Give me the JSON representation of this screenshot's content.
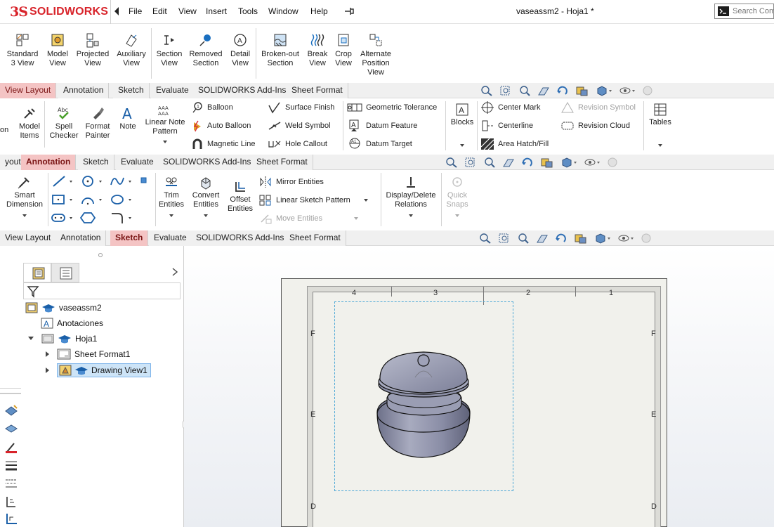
{
  "app": {
    "logo_prefix": "3S",
    "logo_name": "SOLIDWORKS",
    "brand_color": "#d8232a"
  },
  "menu": {
    "items": [
      "File",
      "Edit",
      "View",
      "Insert",
      "Tools",
      "Window",
      "Help"
    ]
  },
  "window": {
    "title": "vaseassm2 - Hoja1 *"
  },
  "search": {
    "placeholder": "Search Com"
  },
  "view_layout_toolbar": [
    {
      "label": "Standard\n3 View",
      "icon": "standard-3-view-icon"
    },
    {
      "label": "Model\nView",
      "icon": "model-view-icon"
    },
    {
      "label": "Projected\nView",
      "icon": "projected-view-icon"
    },
    {
      "label": "Auxiliary\nView",
      "icon": "auxiliary-view-icon"
    },
    {
      "label": "Section\nView",
      "icon": "section-view-icon"
    },
    {
      "label": "Removed\nSection",
      "icon": "removed-section-icon"
    },
    {
      "label": "Detail\nView",
      "icon": "detail-view-icon"
    },
    {
      "label": "Broken-out\nSection",
      "icon": "broken-out-section-icon"
    },
    {
      "label": "Break\nView",
      "icon": "break-view-icon"
    },
    {
      "label": "Crop\nView",
      "icon": "crop-view-icon"
    },
    {
      "label": "Alternate\nPosition\nView",
      "icon": "alternate-position-view-icon"
    }
  ],
  "tabs_row1": [
    "View Layout",
    "Annotation",
    "Sketch",
    "Evaluate",
    "SOLIDWORKS Add-Ins",
    "Sheet Format"
  ],
  "tabs_row1_active": "View Layout",
  "annotation_toolbar": {
    "partial_left": "on",
    "model_items": "Model\nItems",
    "spell_checker": "Spell\nChecker",
    "format_painter": "Format\nPainter",
    "note": "Note",
    "linear_note_pattern": "Linear Note\nPattern",
    "balloon": "Balloon",
    "auto_balloon": "Auto Balloon",
    "magnetic_line": "Magnetic Line",
    "surface_finish": "Surface Finish",
    "weld_symbol": "Weld Symbol",
    "hole_callout": "Hole Callout",
    "geometric_tolerance": "Geometric Tolerance",
    "datum_feature": "Datum Feature",
    "datum_target": "Datum Target",
    "blocks": "Blocks",
    "center_mark": "Center Mark",
    "centerline": "Centerline",
    "area_hatch": "Area Hatch/Fill",
    "revision_symbol": "Revision Symbol",
    "revision_cloud": "Revision Cloud",
    "tables": "Tables"
  },
  "tabs_row2": [
    "yout",
    "Annotation",
    "Sketch",
    "Evaluate",
    "SOLIDWORKS Add-Ins",
    "Sheet Format"
  ],
  "tabs_row2_active": "Annotation",
  "sketch_toolbar": {
    "smart_dimension": "Smart\nDimension",
    "trim_entities": "Trim\nEntities",
    "convert_entities": "Convert\nEntities",
    "offset_entities": "Offset\nEntities",
    "mirror_entities": "Mirror Entities",
    "linear_sketch_pattern": "Linear Sketch Pattern",
    "move_entities": "Move Entities",
    "display_delete_relations": "Display/Delete\nRelations",
    "quick_snaps": "Quick\nSnaps"
  },
  "tabs_row3": [
    "View Layout",
    "Annotation",
    "Sketch",
    "Evaluate",
    "SOLIDWORKS Add-Ins",
    "Sheet Format"
  ],
  "tabs_row3_active": "Sketch",
  "feature_tree": {
    "root": "vaseassm2",
    "items": [
      {
        "label": "Anotaciones",
        "icon": "annotations-icon"
      },
      {
        "label": "Hoja1",
        "icon": "sheet-icon"
      },
      {
        "label": "Sheet Format1",
        "icon": "sheet-format-icon"
      },
      {
        "label": "Drawing View1",
        "icon": "drawing-view-icon",
        "selected": true
      }
    ]
  },
  "drawing_sheet": {
    "zone_columns": [
      "4",
      "3",
      "2",
      "1"
    ],
    "zone_rows": [
      "F",
      "E",
      "D"
    ],
    "view_border_color": "#49a6d6",
    "model_color": "#8b8fa8"
  }
}
